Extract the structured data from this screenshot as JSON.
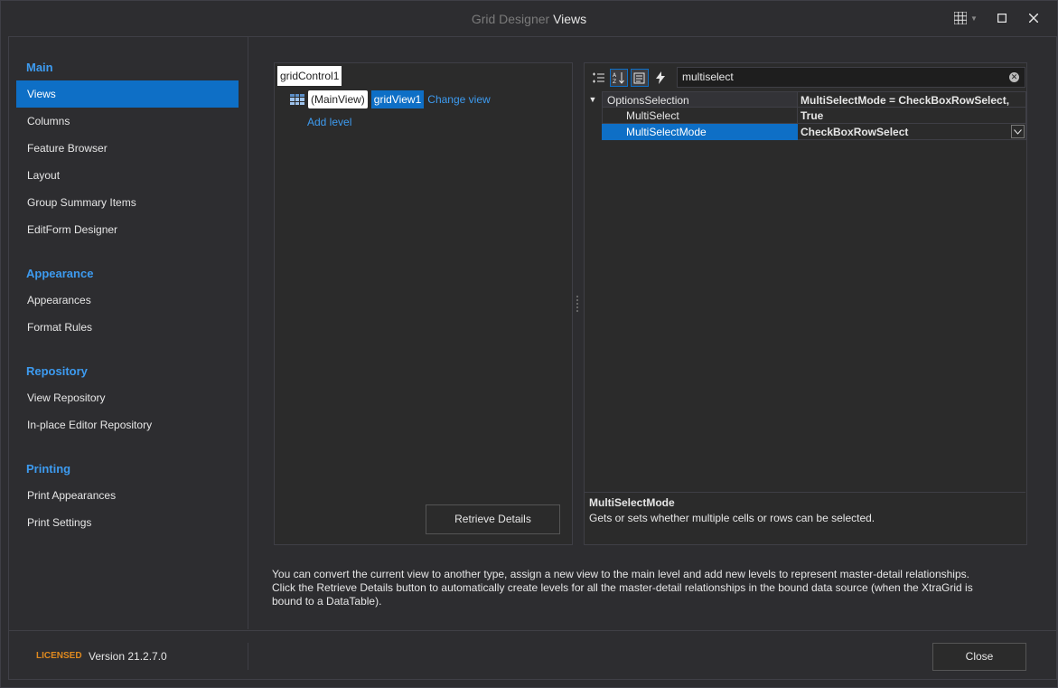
{
  "window": {
    "app_name": "Grid Designer",
    "separator": "",
    "document_name": "Views"
  },
  "nav": {
    "groups": [
      {
        "title": "Main",
        "items": [
          "Views",
          "Columns",
          "Feature Browser",
          "Layout",
          "Group Summary Items",
          "EditForm Designer"
        ]
      },
      {
        "title": "Appearance",
        "items": [
          "Appearances",
          "Format Rules"
        ]
      },
      {
        "title": "Repository",
        "items": [
          "View Repository",
          "In-place Editor Repository"
        ]
      },
      {
        "title": "Printing",
        "items": [
          "Print Appearances",
          "Print Settings"
        ]
      }
    ],
    "selected": "Views"
  },
  "levels": {
    "root": "gridControl1",
    "main_view_label": "(MainView)",
    "view_name": "gridView1",
    "change_view": "Change view",
    "add_level": "Add level",
    "retrieve_button": "Retrieve Details"
  },
  "properties": {
    "search_value": "multiselect",
    "rows": [
      {
        "name": "OptionsSelection",
        "value": "MultiSelectMode = CheckBoxRowSelect, ",
        "expanded": true
      },
      {
        "name": "MultiSelect",
        "value": "True"
      },
      {
        "name": "MultiSelectMode",
        "value": "CheckBoxRowSelect",
        "selected": true
      }
    ],
    "description_title": "MultiSelectMode",
    "description_text": "Gets or sets whether multiple cells or rows can be selected."
  },
  "hint": {
    "line1": "You can convert the current view to another type, assign a new view to the main level and add new levels to represent master-detail relationships.",
    "line2": "Click the Retrieve Details button to automatically create levels for all the master-detail relationships in the bound data source (when the XtraGrid is",
    "line3": "bound to a DataTable)."
  },
  "footer": {
    "licensed": "LICENSED",
    "version": "Version 21.2.7.0",
    "close_button": "Close"
  },
  "colors": {
    "accent": "#0e6fc6",
    "link": "#3d9bf0",
    "licensed": "#e08a1e",
    "background": "#2d2d30"
  }
}
